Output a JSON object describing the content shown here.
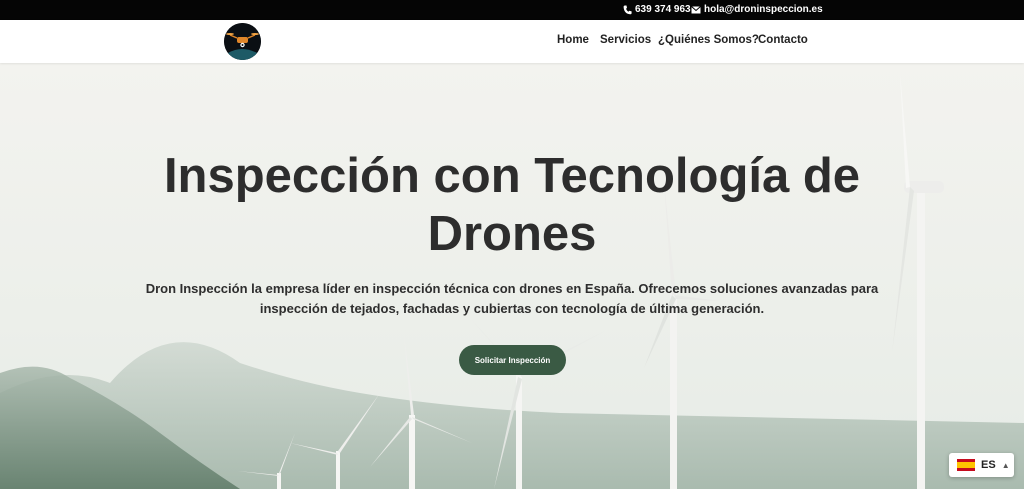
{
  "topbar": {
    "phone": "639 374 963",
    "email": "hola@droninspeccion.es",
    "phone_icon": "phone-icon",
    "email_icon": "envelope-icon"
  },
  "header": {
    "logo_icon": "drone-logo-icon",
    "nav": [
      "Home",
      "Servicios",
      "¿Quiénes Somos?",
      "Contacto"
    ]
  },
  "hero": {
    "title_line1": "Inspección con Tecnología de",
    "title_line2": "Drones",
    "subtitle_line1": "Dron Inspección la empresa líder en inspección técnica con drones en España. Ofrecemos soluciones avanzadas para",
    "subtitle_line2": "inspección de tejados, fachadas y cubiertas con tecnología de última generación.",
    "cta_label": "Solicitar Inspección"
  },
  "language_switcher": {
    "code": "ES",
    "flag_icon": "spain-flag-icon",
    "caret_icon": "chevron-up-icon"
  },
  "colors": {
    "topbar_bg": "#050505",
    "cta_bg": "#3a5a44",
    "text_dark": "#2d2d2d"
  }
}
